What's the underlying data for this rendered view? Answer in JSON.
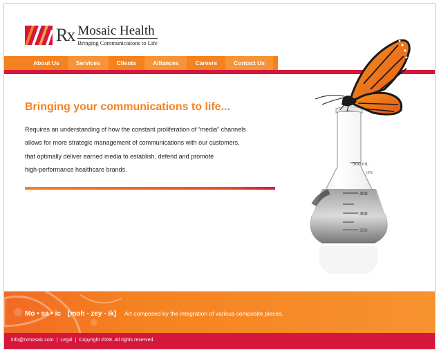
{
  "brand": {
    "rx": "Rx",
    "name": "Mosaic Health",
    "tagline": "Bringing Communications to Life",
    "colors": {
      "orange": "#f58220",
      "red": "#d5173c"
    }
  },
  "nav": {
    "items": [
      {
        "label": "About Us"
      },
      {
        "label": "Services"
      },
      {
        "label": "Clients"
      },
      {
        "label": "Alliances"
      },
      {
        "label": "Careers"
      },
      {
        "label": "Contact Us"
      }
    ]
  },
  "main": {
    "headline": "Bringing your communications to life...",
    "body_lines": [
      "Requires an understanding of how the constant proliferation of “media” channels",
      "allows for more strategic management of communications with our customers,",
      "that optimally deliver earned media to establish, defend and promote",
      "high-performance healthcare brands."
    ]
  },
  "illustration": {
    "flask_markings": [
      "500 mL",
      "400",
      "300",
      "200"
    ],
    "flask_mark_small": "±5%",
    "icons": [
      "butterfly-icon",
      "flask-icon"
    ]
  },
  "band": {
    "word": "Mo • sa • ic",
    "phonetic": "[moh - zey - ik]",
    "definition": "Art composed by the integration of various composite pieces."
  },
  "footer": {
    "email": "info@rxmosaic.com",
    "sep": "|",
    "legal": "Legal",
    "copyright": "Copyright 2008. All rights reserved."
  }
}
